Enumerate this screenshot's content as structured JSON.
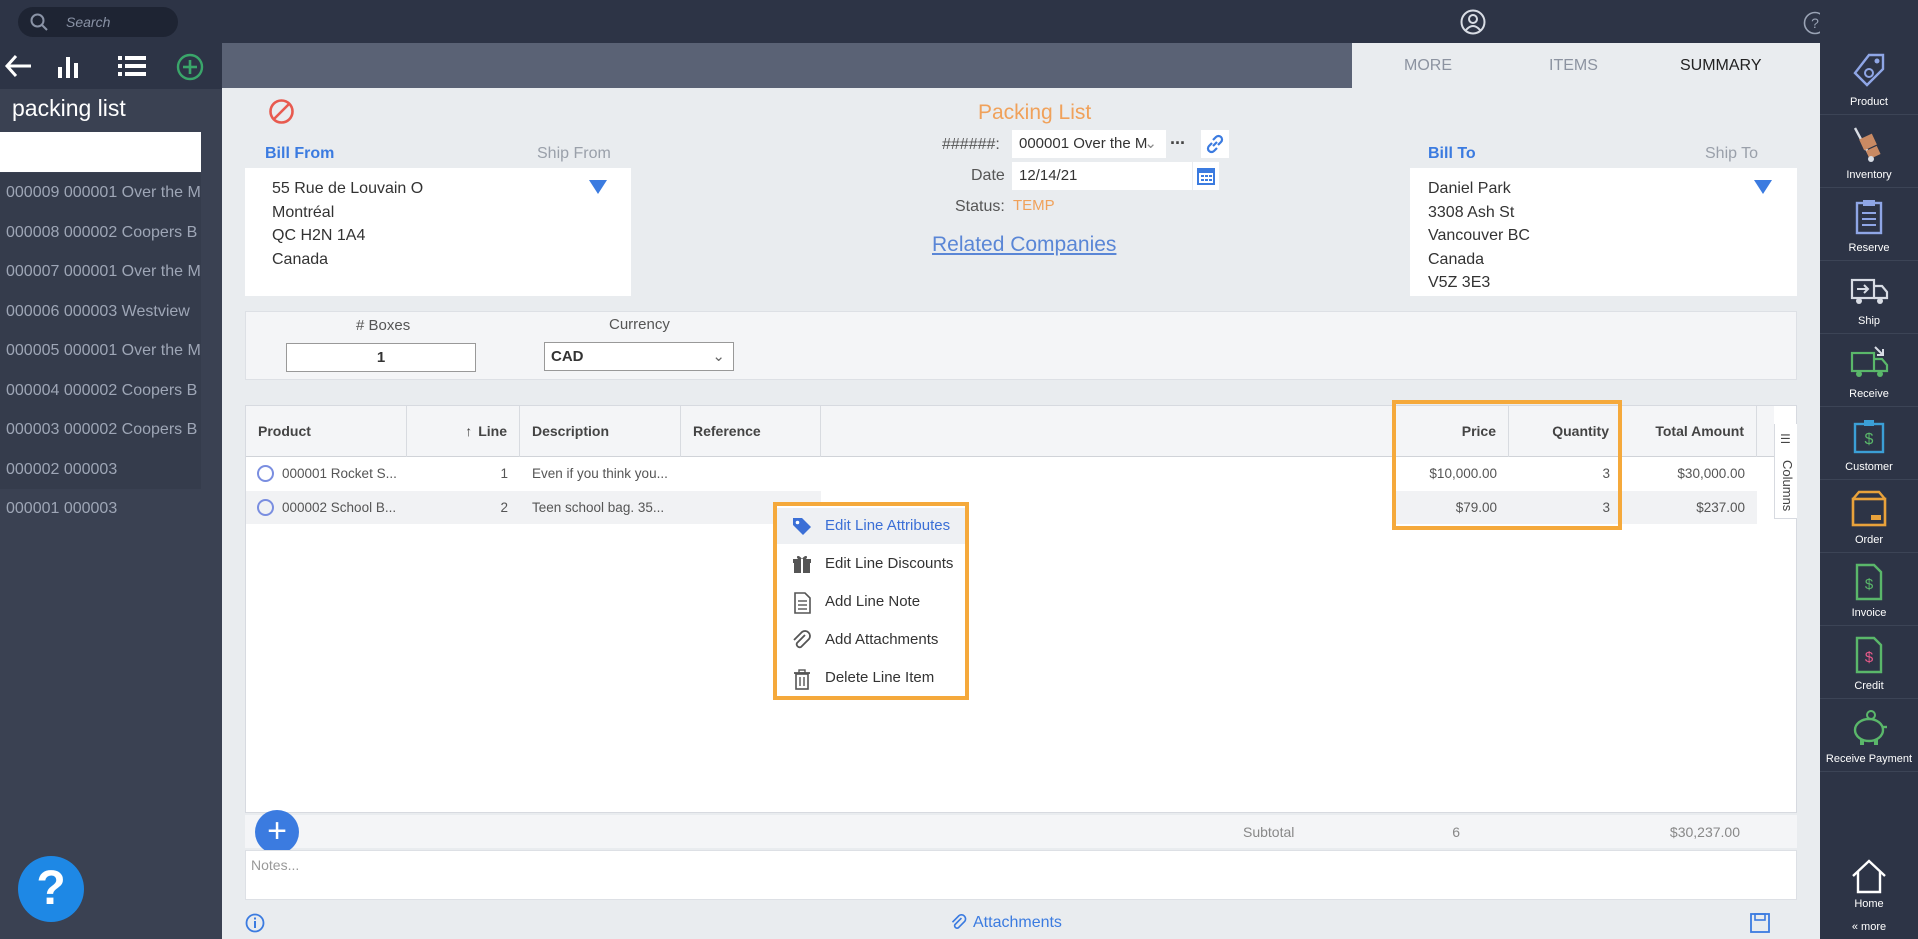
{
  "topbar": {
    "search_placeholder": "Search"
  },
  "sidebar": {
    "title": "packing list",
    "items": [
      "000009 000001 Over the M",
      "000008 000002 Coopers B",
      "000007 000001 Over the M",
      "000006 000003 Westview",
      "000005 000001 Over the M",
      "000004 000002 Coopers B",
      "000003 000002 Coopers B",
      "000002 000003",
      "000001 000003"
    ],
    "help": "?"
  },
  "tabs": [
    "MORE",
    "ITEMS",
    "SUMMARY"
  ],
  "header": {
    "title": "Packing List",
    "number_label": "######:",
    "number_value": "000001 Over the M",
    "number_more": "...",
    "date_label": "Date",
    "date_value": "12/14/21",
    "status_label": "Status:",
    "status_value": "TEMP",
    "related": "Related Companies"
  },
  "bill_from": {
    "label": "Bill From",
    "alt_label": "Ship From",
    "lines": [
      "55 Rue de Louvain O",
      "Montréal",
      "QC H2N 1A4",
      "Canada"
    ]
  },
  "bill_to": {
    "label": "Bill To",
    "alt_label": "Ship To",
    "lines": [
      "Daniel Park",
      "3308 Ash St",
      "Vancouver BC",
      "Canada",
      "V5Z 3E3"
    ]
  },
  "options": {
    "boxes_label": "# Boxes",
    "boxes_value": "1",
    "currency_label": "Currency",
    "currency_value": "CAD"
  },
  "table": {
    "headers": {
      "product": "Product",
      "line": "Line",
      "description": "Description",
      "reference": "Reference",
      "price": "Price",
      "quantity": "Quantity",
      "total": "Total Amount"
    },
    "columns_tab": "Columns",
    "rows": [
      {
        "product": "000001 Rocket S...",
        "line": "1",
        "description": "Even if you think you...",
        "reference": "",
        "price": "$10,000.00",
        "quantity": "3",
        "total": "$30,000.00"
      },
      {
        "product": "000002 School B...",
        "line": "2",
        "description": "Teen school bag. 35...",
        "reference": "",
        "price": "$79.00",
        "quantity": "3",
        "total": "$237.00"
      }
    ]
  },
  "context_menu": [
    {
      "label": "Edit Line Attributes",
      "icon": "tag-icon"
    },
    {
      "label": "Edit Line Discounts",
      "icon": "gift-icon"
    },
    {
      "label": "Add Line Note",
      "icon": "note-icon"
    },
    {
      "label": "Add Attachments",
      "icon": "paperclip-icon"
    },
    {
      "label": "Delete Line Item",
      "icon": "trash-icon"
    }
  ],
  "subtotal": {
    "label": "Subtotal",
    "quantity": "6",
    "total": "$30,237.00"
  },
  "notes_placeholder": "Notes...",
  "footer": {
    "attachments": "Attachments"
  },
  "rail": [
    {
      "label": "Product",
      "icon": "product-tag-icon",
      "color": "#8fa6e6"
    },
    {
      "label": "Inventory",
      "icon": "hand-truck-icon",
      "color": "#c98a63"
    },
    {
      "label": "Reserve",
      "icon": "clipboard-icon",
      "color": "#8fa6e6"
    },
    {
      "label": "Ship",
      "icon": "ship-truck-icon",
      "color": "#d8dce4"
    },
    {
      "label": "Receive",
      "icon": "receive-truck-icon",
      "color": "#5ab76a"
    },
    {
      "label": "Customer",
      "icon": "customer-icon",
      "color": "#3b9fd6"
    },
    {
      "label": "Order",
      "icon": "order-box-icon",
      "color": "#e9a23b"
    },
    {
      "label": "Invoice",
      "icon": "invoice-icon",
      "color": "#5ab76a"
    },
    {
      "label": "Credit",
      "icon": "credit-icon",
      "color": "#5ab76a"
    },
    {
      "label": "Receive Payment",
      "icon": "piggy-bank-icon",
      "color": "#5ab76a"
    }
  ],
  "rail_home": "Home",
  "rail_more": "« more",
  "colors": {
    "accent": "#3b7be0",
    "highlight": "#f5a93b",
    "title": "#f0a15a",
    "dark": "#2d3446"
  }
}
